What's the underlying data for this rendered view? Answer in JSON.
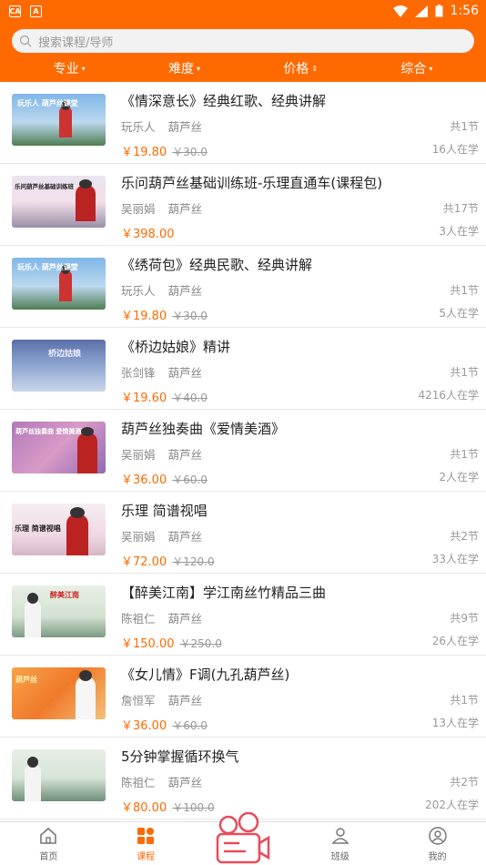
{
  "status_bar": {
    "time": "1:56"
  },
  "search": {
    "placeholder": "搜索课程/导师"
  },
  "filters": [
    {
      "label": "专业",
      "caret": "▾"
    },
    {
      "label": "难度",
      "caret": "▾"
    },
    {
      "label": "价格",
      "caret": "⇕"
    },
    {
      "label": "综合",
      "caret": "▾"
    }
  ],
  "courses": [
    {
      "title": "《情深意长》经典红歌、经典讲解",
      "teacher": "玩乐人",
      "category": "葫芦丝",
      "lessons": "共1节",
      "price": "￥19.80",
      "original_price": "￥30.0",
      "learners": "16人在学",
      "thumb_text": "玩乐人 葫芦丝课堂"
    },
    {
      "title": "乐问葫芦丝基础训练班-乐理直通车(课程包)",
      "teacher": "吴丽娟",
      "category": "葫芦丝",
      "lessons": "共17节",
      "price": "￥398.00",
      "original_price": "",
      "learners": "3人在学",
      "thumb_text": "乐问葫芦丝基础训练班"
    },
    {
      "title": "《绣荷包》经典民歌、经典讲解",
      "teacher": "玩乐人",
      "category": "葫芦丝",
      "lessons": "共1节",
      "price": "￥19.80",
      "original_price": "￥30.0",
      "learners": "5人在学",
      "thumb_text": "玩乐人 葫芦丝课堂"
    },
    {
      "title": "《桥边姑娘》精讲",
      "teacher": "张剑锋",
      "category": "葫芦丝",
      "lessons": "共1节",
      "price": "￥19.60",
      "original_price": "￥40.0",
      "learners": "4216人在学",
      "thumb_text": "桥边姑娘"
    },
    {
      "title": "葫芦丝独奏曲《爱情美酒》",
      "teacher": "吴丽娟",
      "category": "葫芦丝",
      "lessons": "共1节",
      "price": "￥36.00",
      "original_price": "￥60.0",
      "learners": "2人在学",
      "thumb_text": "葫芦丝独奏曲 爱情美酒"
    },
    {
      "title": "乐理 简谱视唱",
      "teacher": "吴丽娟",
      "category": "葫芦丝",
      "lessons": "共2节",
      "price": "￥72.00",
      "original_price": "￥120.0",
      "learners": "33人在学",
      "thumb_text": "乐理 简谱视唱"
    },
    {
      "title": "【醉美江南】学江南丝竹精品三曲",
      "teacher": "陈祖仁",
      "category": "葫芦丝",
      "lessons": "共9节",
      "price": "￥150.00",
      "original_price": "￥250.0",
      "learners": "26人在学",
      "thumb_text": "醉美江南"
    },
    {
      "title": "《女儿情》F调(九孔葫芦丝)",
      "teacher": "詹恒军",
      "category": "葫芦丝",
      "lessons": "共1节",
      "price": "￥36.00",
      "original_price": "￥60.0",
      "learners": "13人在学",
      "thumb_text": "葫芦丝"
    },
    {
      "title": "5分钟掌握循环换气",
      "teacher": "陈祖仁",
      "category": "葫芦丝",
      "lessons": "共2节",
      "price": "￥80.00",
      "original_price": "￥100.0",
      "learners": "202人在学",
      "thumb_text": ""
    }
  ],
  "bottom_nav": [
    {
      "label": "首页",
      "icon": "home-icon"
    },
    {
      "label": "课程",
      "icon": "course-grid-icon"
    },
    {
      "label": "",
      "icon": "camera-icon"
    },
    {
      "label": "班级",
      "icon": "class-icon"
    },
    {
      "label": "我的",
      "icon": "profile-icon"
    }
  ],
  "colors": {
    "accent": "#ff6a00"
  }
}
